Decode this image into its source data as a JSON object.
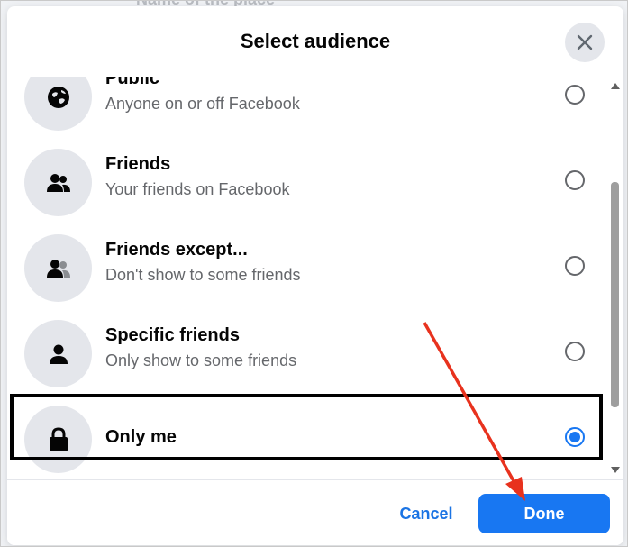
{
  "dialog": {
    "title": "Select audience",
    "background_text": "Name of the place"
  },
  "options": [
    {
      "label": "Public",
      "sub": "Anyone on or off Facebook",
      "icon": "globe-icon",
      "selected": false
    },
    {
      "label": "Friends",
      "sub": "Your friends on Facebook",
      "icon": "friends-icon",
      "selected": false
    },
    {
      "label": "Friends except...",
      "sub": "Don't show to some friends",
      "icon": "friends-except-icon",
      "selected": false
    },
    {
      "label": "Specific friends",
      "sub": "Only show to some friends",
      "icon": "person-icon",
      "selected": false
    },
    {
      "label": "Only me",
      "sub": "",
      "icon": "lock-icon",
      "selected": true
    }
  ],
  "footer": {
    "cancel_label": "Cancel",
    "done_label": "Done"
  },
  "colors": {
    "accent": "#1877f2",
    "annotation_arrow": "#e8321e",
    "highlight_box": "#000000"
  }
}
